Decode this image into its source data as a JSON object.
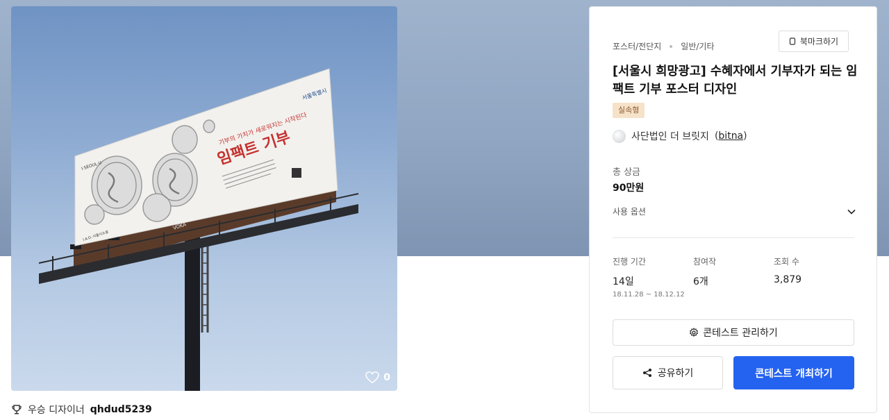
{
  "artwork": {
    "likes": "0",
    "billboard": {
      "brand": "서울특별시",
      "brand_left": "I·SEOUL·U",
      "headline": "임팩트 기부",
      "tagline": "기부의 가치가 새로워지는 시작된다",
      "footer_left": "I.A.D.·서울시소셜",
      "stand_label": "VOKA"
    }
  },
  "designer": {
    "label": "우승 디자이너",
    "name": "qhdud5239",
    "icon": "trophy-icon"
  },
  "panel": {
    "categories": [
      "포스터/전단지",
      "일반/기타"
    ],
    "bookmark_label": "북마크하기",
    "title": "[서울시 희망광고] 수혜자에서 기부자가 되는 임팩트 기부 포스터 디자인",
    "badge": "실속형",
    "host": {
      "name": "사단법인 더 브릿지",
      "id": "bitna"
    },
    "prize": {
      "label": "총 상금",
      "value": "90만원"
    },
    "options_label": "사용 옵션",
    "stats": {
      "period": {
        "label": "진행 기간",
        "value": "14일",
        "dates": "18.11.28 ~ 18.12.12"
      },
      "entries": {
        "label": "참여작",
        "value": "6개"
      },
      "views": {
        "label": "조회 수",
        "value": "3,879"
      }
    },
    "manage_label": "콘테스트 관리하기",
    "share_label": "공유하기",
    "host_contest_label": "콘테스트 개최하기"
  },
  "colors": {
    "primary": "#2462f0",
    "badge_bg": "#f6e2c9",
    "badge_text": "#8a5a2e",
    "banner": "#8ea4c0"
  }
}
